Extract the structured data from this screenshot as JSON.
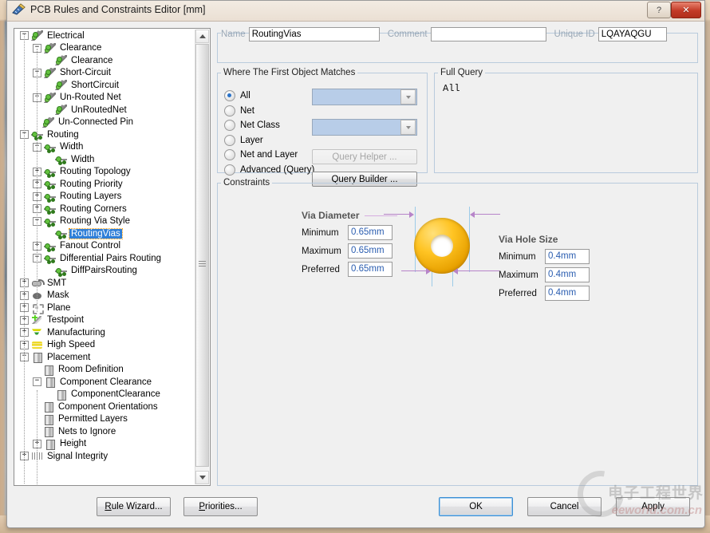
{
  "window": {
    "title": "PCB Rules and Constraints Editor [mm]",
    "app_icon": "ruler-icon",
    "help_button": "?",
    "close_button": "✕"
  },
  "tree": {
    "nodes": [
      {
        "label": "Electrical",
        "depth": 0,
        "expander": "minus",
        "icon": "ic-elec"
      },
      {
        "label": "Clearance",
        "depth": 1,
        "expander": "minus",
        "icon": "ic-elec"
      },
      {
        "label": "Clearance",
        "depth": 2,
        "expander": "none",
        "icon": "ic-elec"
      },
      {
        "label": "Short-Circuit",
        "depth": 1,
        "expander": "minus",
        "icon": "ic-elec"
      },
      {
        "label": "ShortCircuit",
        "depth": 2,
        "expander": "none",
        "icon": "ic-elec"
      },
      {
        "label": "Un-Routed Net",
        "depth": 1,
        "expander": "minus",
        "icon": "ic-elec"
      },
      {
        "label": "UnRoutedNet",
        "depth": 2,
        "expander": "none",
        "icon": "ic-elec"
      },
      {
        "label": "Un-Connected Pin",
        "depth": 1,
        "expander": "none",
        "icon": "ic-elec"
      },
      {
        "label": "Routing",
        "depth": 0,
        "expander": "minus",
        "icon": "ic-route"
      },
      {
        "label": "Width",
        "depth": 1,
        "expander": "minus",
        "icon": "ic-route"
      },
      {
        "label": "Width",
        "depth": 2,
        "expander": "none",
        "icon": "ic-route"
      },
      {
        "label": "Routing Topology",
        "depth": 1,
        "expander": "plus",
        "icon": "ic-route"
      },
      {
        "label": "Routing Priority",
        "depth": 1,
        "expander": "plus",
        "icon": "ic-route"
      },
      {
        "label": "Routing Layers",
        "depth": 1,
        "expander": "plus",
        "icon": "ic-route"
      },
      {
        "label": "Routing Corners",
        "depth": 1,
        "expander": "plus",
        "icon": "ic-route"
      },
      {
        "label": "Routing Via Style",
        "depth": 1,
        "expander": "minus",
        "icon": "ic-route"
      },
      {
        "label": "RoutingVias",
        "depth": 2,
        "expander": "none",
        "icon": "ic-route",
        "selected": true
      },
      {
        "label": "Fanout Control",
        "depth": 1,
        "expander": "plus",
        "icon": "ic-route"
      },
      {
        "label": "Differential Pairs Routing",
        "depth": 1,
        "expander": "minus",
        "icon": "ic-route"
      },
      {
        "label": "DiffPairsRouting",
        "depth": 2,
        "expander": "none",
        "icon": "ic-route"
      },
      {
        "label": "SMT",
        "depth": 0,
        "expander": "plus",
        "icon": "ic-smt"
      },
      {
        "label": "Mask",
        "depth": 0,
        "expander": "plus",
        "icon": "ic-mask"
      },
      {
        "label": "Plane",
        "depth": 0,
        "expander": "plus",
        "icon": "ic-plane"
      },
      {
        "label": "Testpoint",
        "depth": 0,
        "expander": "plus",
        "icon": "ic-test"
      },
      {
        "label": "Manufacturing",
        "depth": 0,
        "expander": "plus",
        "icon": "ic-manu"
      },
      {
        "label": "High Speed",
        "depth": 0,
        "expander": "plus",
        "icon": "ic-hs"
      },
      {
        "label": "Placement",
        "depth": 0,
        "expander": "minus",
        "icon": "ic-place"
      },
      {
        "label": "Room Definition",
        "depth": 1,
        "expander": "none",
        "icon": "ic-place"
      },
      {
        "label": "Component Clearance",
        "depth": 1,
        "expander": "minus",
        "icon": "ic-place"
      },
      {
        "label": "ComponentClearance",
        "depth": 2,
        "expander": "none",
        "icon": "ic-place"
      },
      {
        "label": "Component Orientations",
        "depth": 1,
        "expander": "none",
        "icon": "ic-place"
      },
      {
        "label": "Permitted Layers",
        "depth": 1,
        "expander": "none",
        "icon": "ic-place"
      },
      {
        "label": "Nets to Ignore",
        "depth": 1,
        "expander": "none",
        "icon": "ic-place"
      },
      {
        "label": "Height",
        "depth": 1,
        "expander": "plus",
        "icon": "ic-place"
      },
      {
        "label": "Signal Integrity",
        "depth": 0,
        "expander": "plus",
        "icon": "ic-si"
      }
    ]
  },
  "header": {
    "name_label": "Name",
    "name_value": "RoutingVias",
    "comment_label": "Comment",
    "comment_value": "",
    "comment_placeholder": "",
    "unique_id_label": "Unique ID",
    "unique_id_value": "LQAYAQGU"
  },
  "match": {
    "legend": "Where The First Object Matches",
    "options": [
      {
        "label": "All",
        "selected": true
      },
      {
        "label": "Net",
        "selected": false
      },
      {
        "label": "Net Class",
        "selected": false
      },
      {
        "label": "Layer",
        "selected": false
      },
      {
        "label": "Net and Layer",
        "selected": false
      },
      {
        "label": "Advanced (Query)",
        "selected": false
      }
    ],
    "net_combo_value": "",
    "net_class_combo_value": "",
    "query_helper_label": "Query Helper ...",
    "query_helper_enabled": false,
    "query_builder_label": "Query Builder ...",
    "query_builder_enabled": true
  },
  "full_query": {
    "legend": "Full Query",
    "text": "All"
  },
  "constraints": {
    "legend": "Constraints",
    "via_diameter": {
      "title": "Via Diameter",
      "rows": [
        {
          "label": "Minimum",
          "value": "0.65mm"
        },
        {
          "label": "Maximum",
          "value": "0.65mm"
        },
        {
          "label": "Preferred",
          "value": "0.65mm"
        }
      ]
    },
    "via_hole_size": {
      "title": "Via Hole Size",
      "rows": [
        {
          "label": "Minimum",
          "value": "0.4mm"
        },
        {
          "label": "Maximum",
          "value": "0.4mm"
        },
        {
          "label": "Preferred",
          "value": "0.4mm"
        }
      ]
    },
    "via_graphic": "via-donut-diagram"
  },
  "footer": {
    "rule_wizard": "Rule Wizard...",
    "rule_wizard_accel": "R",
    "priorities": "Priorities...",
    "priorities_accel": "P",
    "ok": "OK",
    "cancel": "Cancel",
    "apply": "Apply"
  },
  "watermark": {
    "cn": "电子工程世界",
    "en": "eeworld.com.cn"
  },
  "colors": {
    "selection": "#2f7fd8",
    "value_text": "#2a5db0",
    "via_gold": "#ffc423",
    "dimension_arrow": "#b784c9",
    "guide_line": "#9dcbe8",
    "group_border": "#b9cbdd",
    "close_red": "#c33a26"
  }
}
